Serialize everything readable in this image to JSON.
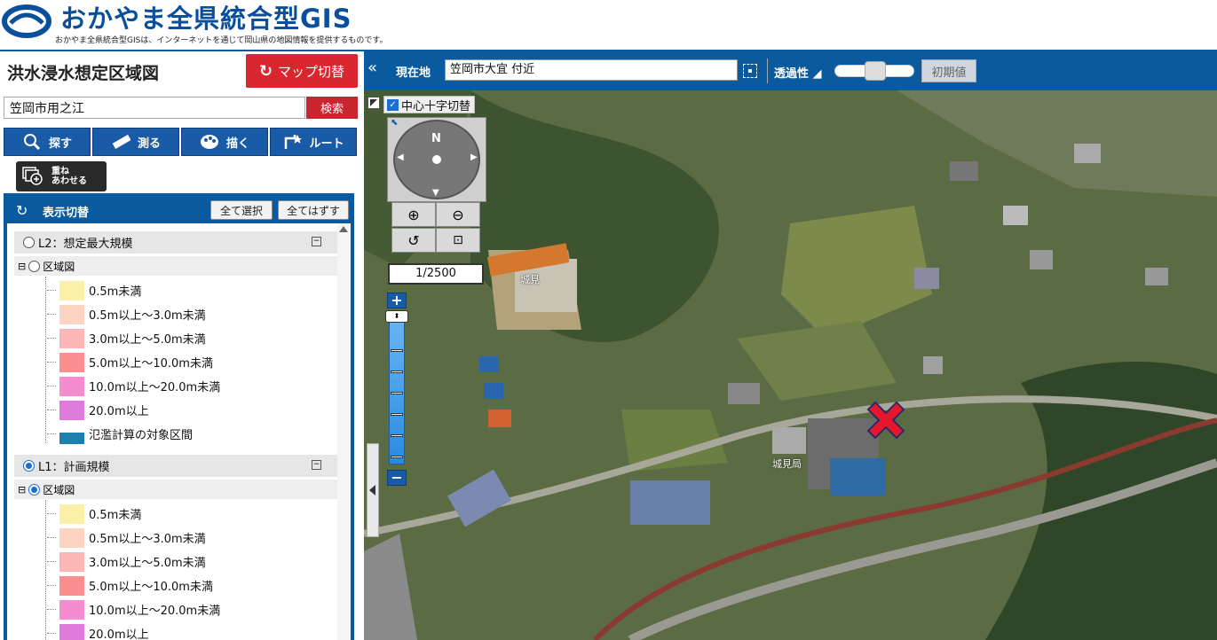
{
  "header": {
    "title": "おかやま全県統合型GIS",
    "subtitle": "おかやま全県統合型GISは、インターネットを通じて岡山県の地図情報を提供するものです。"
  },
  "sidebar": {
    "map_title": "洪水浸水想定区域図",
    "map_switch_label": "マップ切替",
    "search_value": "笠岡市用之江",
    "search_button": "検索",
    "tools": [
      {
        "label": "探す",
        "icon": "magnifier-icon"
      },
      {
        "label": "測る",
        "icon": "ruler-icon"
      },
      {
        "label": "描く",
        "icon": "palette-icon"
      },
      {
        "label": "ルート",
        "icon": "route-icon"
      }
    ],
    "overlay_label_1": "重ね",
    "overlay_label_2": "あわせる",
    "layer_panel": {
      "title": "表示切替",
      "select_all": "全て選択",
      "deselect_all": "全てはずす",
      "groups": [
        {
          "label": "L2：想定最大規模",
          "selected": false,
          "sub_label": "区域図",
          "sub_selected": false,
          "legend": [
            {
              "label": "0.5m未満",
              "color": "#fbf0a8"
            },
            {
              "label": "0.5m以上～3.0m未満",
              "color": "#fdd3c2"
            },
            {
              "label": "3.0m以上～5.0m未満",
              "color": "#fcb6b6"
            },
            {
              "label": "5.0m以上～10.0m未満",
              "color": "#fa8d8d"
            },
            {
              "label": "10.0m以上～20.0m未満",
              "color": "#f58ccf"
            },
            {
              "label": "20.0m以上",
              "color": "#de7ad9"
            },
            {
              "label": "氾濫計算の対象区間",
              "color": "#1e7fae"
            }
          ]
        },
        {
          "label": "L1：計画規模",
          "selected": true,
          "sub_label": "区域図",
          "sub_selected": true,
          "legend": [
            {
              "label": "0.5m未満",
              "color": "#fbf0a8"
            },
            {
              "label": "0.5m以上～3.0m未満",
              "color": "#fdd3c2"
            },
            {
              "label": "3.0m以上～5.0m未満",
              "color": "#fcb6b6"
            },
            {
              "label": "5.0m以上～10.0m未満",
              "color": "#fa8d8d"
            },
            {
              "label": "10.0m以上～20.0m未満",
              "color": "#f58ccf"
            },
            {
              "label": "20.0m以上",
              "color": "#de7ad9"
            }
          ]
        }
      ]
    }
  },
  "toolbar": {
    "location_label": "現在地",
    "location_value": "笠岡市大宜 付近",
    "opacity_label": "透過性",
    "reset_label": "初期値"
  },
  "map": {
    "center_toggle_label": "中心十字切替",
    "compass_label": "N",
    "scale": "1/2500",
    "labels": [
      "城見",
      "城見局"
    ]
  }
}
